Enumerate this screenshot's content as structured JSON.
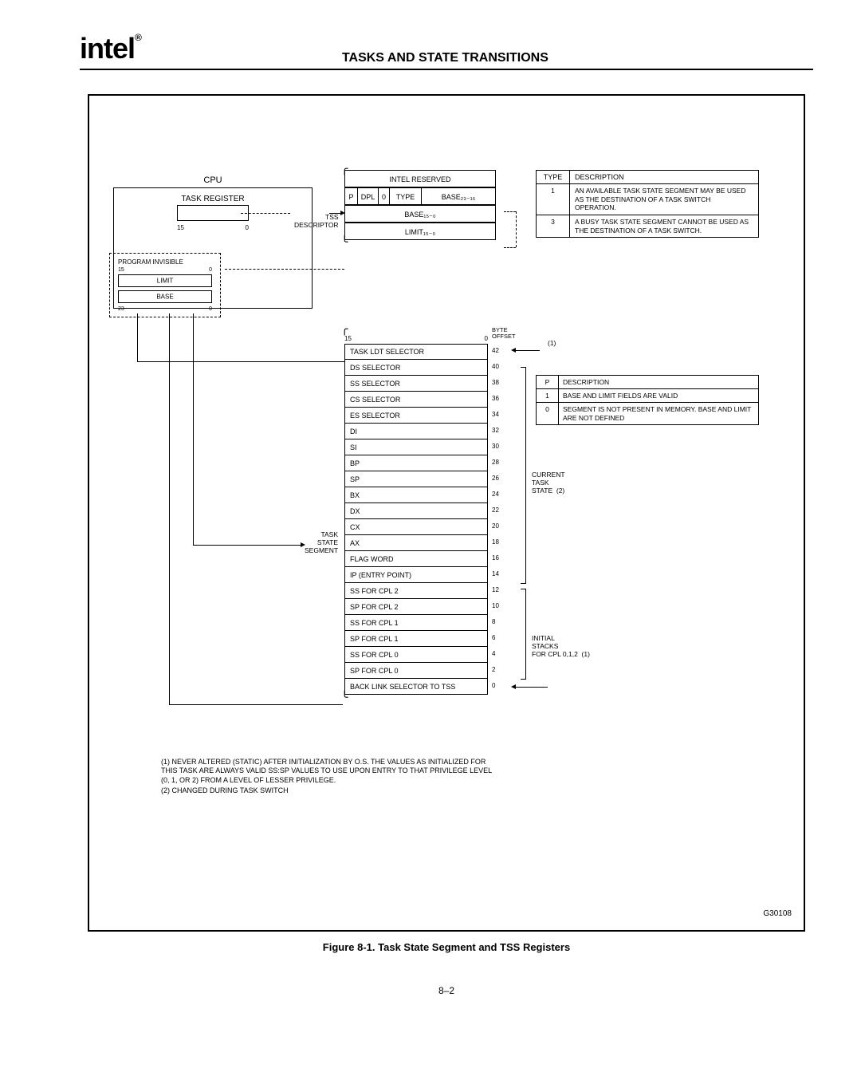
{
  "logo": "intel",
  "page_title": "TASKS AND STATE TRANSITIONS",
  "cpu": {
    "title": "CPU",
    "task_register": "TASK REGISTER",
    "bit_hi": "15",
    "bit_lo": "0",
    "program_invisible": "PROGRAM INVISIBLE",
    "pi_hi": "15",
    "pi_lo": "0",
    "limit": "LIMIT",
    "base": "BASE"
  },
  "tss_desc_label": "TSS\nDESCRIPTOR",
  "descriptor": {
    "reserved": "INTEL RESERVED",
    "p": "P",
    "dpl": "DPL",
    "zero": "0",
    "type": "TYPE",
    "base_hi": "BASE₂₃₋₁₆",
    "base_lo": "BASE₁₅₋₀",
    "limit": "LIMIT₁₅₋₀"
  },
  "type_table": {
    "head1": "TYPE",
    "head2": "DESCRIPTION",
    "r1_type": "1",
    "r1_desc": "AN AVAILABLE TASK STATE SEGMENT MAY BE USED AS THE DESTINATION OF A TASK SWITCH OPERATION.",
    "r2_type": "3",
    "r2_desc": "A BUSY TASK STATE SEGMENT CANNOT BE USED AS THE DESTINATION OF A TASK SWITCH."
  },
  "tss_head": {
    "hi": "15",
    "lo": "0",
    "byte_offset": "BYTE\nOFFSET"
  },
  "tss_rows": [
    {
      "label": "TASK LDT SELECTOR",
      "off": "42"
    },
    {
      "label": "DS SELECTOR",
      "off": "40"
    },
    {
      "label": "SS SELECTOR",
      "off": "38"
    },
    {
      "label": "CS SELECTOR",
      "off": "36"
    },
    {
      "label": "ES SELECTOR",
      "off": "34"
    },
    {
      "label": "DI",
      "off": "32"
    },
    {
      "label": "SI",
      "off": "30"
    },
    {
      "label": "BP",
      "off": "28"
    },
    {
      "label": "SP",
      "off": "26"
    },
    {
      "label": "BX",
      "off": "24"
    },
    {
      "label": "DX",
      "off": "22"
    },
    {
      "label": "CX",
      "off": "20"
    },
    {
      "label": "AX",
      "off": "18"
    },
    {
      "label": "FLAG WORD",
      "off": "16"
    },
    {
      "label": "IP (ENTRY POINT)",
      "off": "14"
    },
    {
      "label": "SS FOR CPL 2",
      "off": "12"
    },
    {
      "label": "SP FOR CPL 2",
      "off": "10"
    },
    {
      "label": "SS FOR CPL 1",
      "off": "8"
    },
    {
      "label": "SP FOR CPL 1",
      "off": "6"
    },
    {
      "label": "SS FOR CPL 0",
      "off": "4"
    },
    {
      "label": "SP FOR CPL 0",
      "off": "2"
    },
    {
      "label": "BACK LINK SELECTOR TO TSS",
      "off": "0"
    }
  ],
  "ref_1": "(1)",
  "p_table": {
    "h1": "P",
    "h2": "DESCRIPTION",
    "r1_p": "1",
    "r1_d": "BASE AND LIMIT FIELDS ARE VALID",
    "r2_p": "0",
    "r2_d": "SEGMENT IS NOT PRESENT IN MEMORY. BASE AND LIMIT ARE NOT DEFINED"
  },
  "side_labels": {
    "current": "CURRENT\nTASK\nSTATE",
    "current_ref": "(2)",
    "stacks": "INITIAL\nSTACKS\nFOR CPL 0,1,2",
    "stacks_ref": "(1)"
  },
  "tss_point_label": "TASK\nSTATE\nSEGMENT",
  "footnotes": {
    "n1": "(1) NEVER ALTERED (STATIC) AFTER INITIALIZATION BY O.S. THE VALUES AS INITIALIZED FOR THIS TASK ARE ALWAYS VALID SS:SP VALUES TO USE UPON ENTRY TO THAT PRIVILEGE LEVEL (0, 1, OR 2) FROM A LEVEL OF LESSER PRIVILEGE.",
    "n2": "(2) CHANGED DURING TASK SWITCH"
  },
  "figure_id": "G30108",
  "caption": "Figure 8-1. Task State Segment and TSS Registers",
  "page_number": "8–2"
}
